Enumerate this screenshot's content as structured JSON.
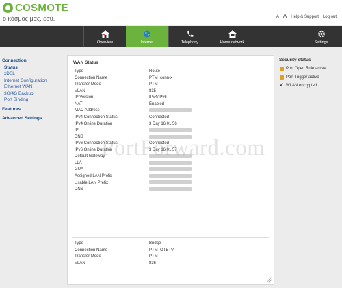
{
  "header": {
    "brand": "COSMOTE",
    "slogan": "ο κόσμος μας, εσύ.",
    "links": {
      "font_small": "A",
      "font_large": "A",
      "help": "Help & Support",
      "logout": "Log out"
    }
  },
  "nav": [
    {
      "label": "Overview",
      "icon": "home-icon"
    },
    {
      "label": "Internet",
      "icon": "globe-icon"
    },
    {
      "label": "Telephony",
      "icon": "phone-icon"
    },
    {
      "label": "Home network",
      "icon": "home-network-icon"
    },
    {
      "label": "Settings",
      "icon": "gear-icon"
    }
  ],
  "sidebar": {
    "connection": "Connection",
    "items": [
      "Status",
      "xDSL",
      "Internet Configuration",
      "Ethernet WAN",
      "3G/4G Backup",
      "Port Binding"
    ],
    "features": "Features",
    "advanced": "Advanced Settings"
  },
  "wan": {
    "title": "WAN Status",
    "rows": [
      {
        "k": "Type",
        "v": "Route"
      },
      {
        "k": "Connection Name",
        "v": "PTM_conn-x"
      },
      {
        "k": "Transfer Mode",
        "v": "PTM"
      },
      {
        "k": "VLAN",
        "v": "835"
      },
      {
        "k": "IP Version",
        "v": "IPv4/IPv6"
      },
      {
        "k": "NAT",
        "v": "Enabled"
      },
      {
        "k": "MAC Address",
        "v": ""
      },
      {
        "k": "IPv4 Connection Status",
        "v": "Connected"
      },
      {
        "k": "IPv4 Online Duration",
        "v": "3 Day 16:01:56"
      },
      {
        "k": "IP",
        "v": ""
      },
      {
        "k": "DNS",
        "v": ""
      },
      {
        "k": "IPv6 Connection Status",
        "v": "Connected"
      },
      {
        "k": "IPv6 Online Duration",
        "v": "3 Day 16:01:57"
      },
      {
        "k": "Default Gateway",
        "v": ""
      },
      {
        "k": "LLA",
        "v": ""
      },
      {
        "k": "GUA",
        "v": ""
      },
      {
        "k": "Assigned LAN Prefix",
        "v": ""
      },
      {
        "k": "Usable LAN Prefix",
        "v": ""
      },
      {
        "k": "DNS",
        "v": ""
      }
    ],
    "rows2": [
      {
        "k": "Type",
        "v": "Bridge"
      },
      {
        "k": "Connection Name",
        "v": "PTM_OTETV"
      },
      {
        "k": "Transfer Mode",
        "v": "PTM"
      },
      {
        "k": "VLAN",
        "v": "836"
      }
    ]
  },
  "security": {
    "title": "Security status",
    "items": [
      "Port Open Rule active",
      "Port Trigger active",
      "WLAN encrypted"
    ]
  },
  "watermark": "PortForward.com",
  "colors": {
    "brand_green": "#6cb33e",
    "nav_bg": "#333333",
    "link_blue": "#1a4a8a"
  }
}
